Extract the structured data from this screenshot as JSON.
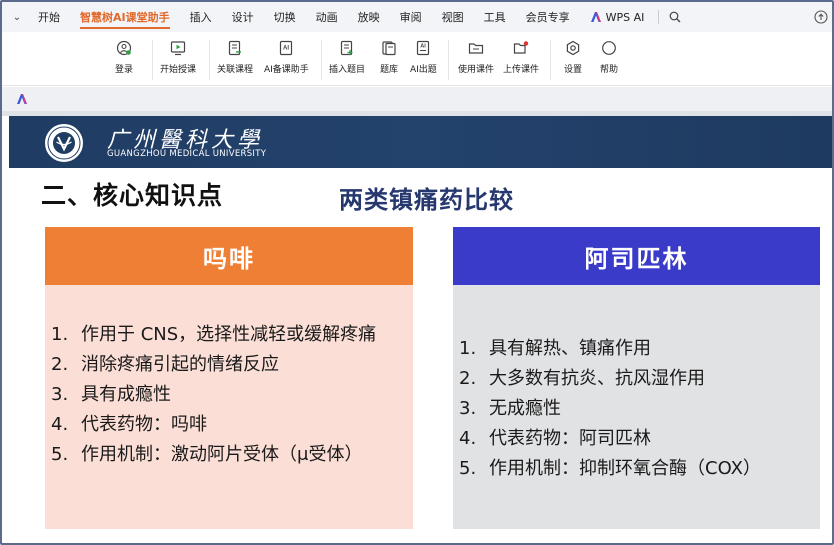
{
  "menubar": {
    "items": [
      "开始",
      "智慧树AI课堂助手",
      "插入",
      "设计",
      "切换",
      "动画",
      "放映",
      "审阅",
      "视图",
      "工具",
      "会员专享"
    ],
    "active_index": 1,
    "wps_ai": "WPS AI"
  },
  "ribbon": {
    "buttons": [
      {
        "label": "登录",
        "icon": "login-icon"
      },
      {
        "label": "开始授课",
        "icon": "play-screen-icon"
      },
      {
        "label": "关联课程",
        "icon": "link-doc-icon"
      },
      {
        "label": "AI备课助手",
        "icon": "ai-doc-icon"
      },
      {
        "label": "插入题目",
        "icon": "insert-question-icon"
      },
      {
        "label": "题库",
        "icon": "question-bank-icon"
      },
      {
        "label": "AI出题",
        "icon": "ai-question-icon"
      },
      {
        "label": "使用课件",
        "icon": "folder-icon"
      },
      {
        "label": "上传课件",
        "icon": "upload-folder-icon"
      },
      {
        "label": "设置",
        "icon": "gear-icon"
      },
      {
        "label": "帮助",
        "icon": "help-icon"
      }
    ]
  },
  "slide": {
    "header": {
      "university_cn": "广州醫科大學",
      "university_en": "GUANGZHOU MEDICAL UNIVERSITY"
    },
    "section_title": "二、核心知识点",
    "subtitle": "两类镇痛药比较",
    "left_card": {
      "title": "吗啡",
      "items": [
        {
          "num": "1.",
          "text": "作用于 CNS，选择性减轻或缓解疼痛"
        },
        {
          "num": "2.",
          "text": "消除疼痛引起的情绪反应"
        },
        {
          "num": "3.",
          "text": "具有成瘾性"
        },
        {
          "num": "4.",
          "text": "代表药物：吗啡"
        },
        {
          "num": "5.",
          "text": "作用机制：激动阿片受体（μ受体）"
        }
      ]
    },
    "right_card": {
      "title": "阿司匹林",
      "items": [
        {
          "num": "1.",
          "text": "具有解热、镇痛作用"
        },
        {
          "num": "2.",
          "text": "大多数有抗炎、抗风湿作用"
        },
        {
          "num": "3.",
          "text": "无成瘾性"
        },
        {
          "num": "4.",
          "text": "代表药物：阿司匹林"
        },
        {
          "num": "5.",
          "text": "作用机制：抑制环氧合酶（COX）"
        }
      ]
    }
  },
  "colors": {
    "accent_orange": "#e0692b",
    "left_card_header": "#ef7f34",
    "left_card_body": "#fbdfd6",
    "right_card_header": "#3a3bc9",
    "right_card_body": "#e1e2e4",
    "slide_header_bg": "#1f3c63",
    "subtitle_color": "#26386e"
  }
}
